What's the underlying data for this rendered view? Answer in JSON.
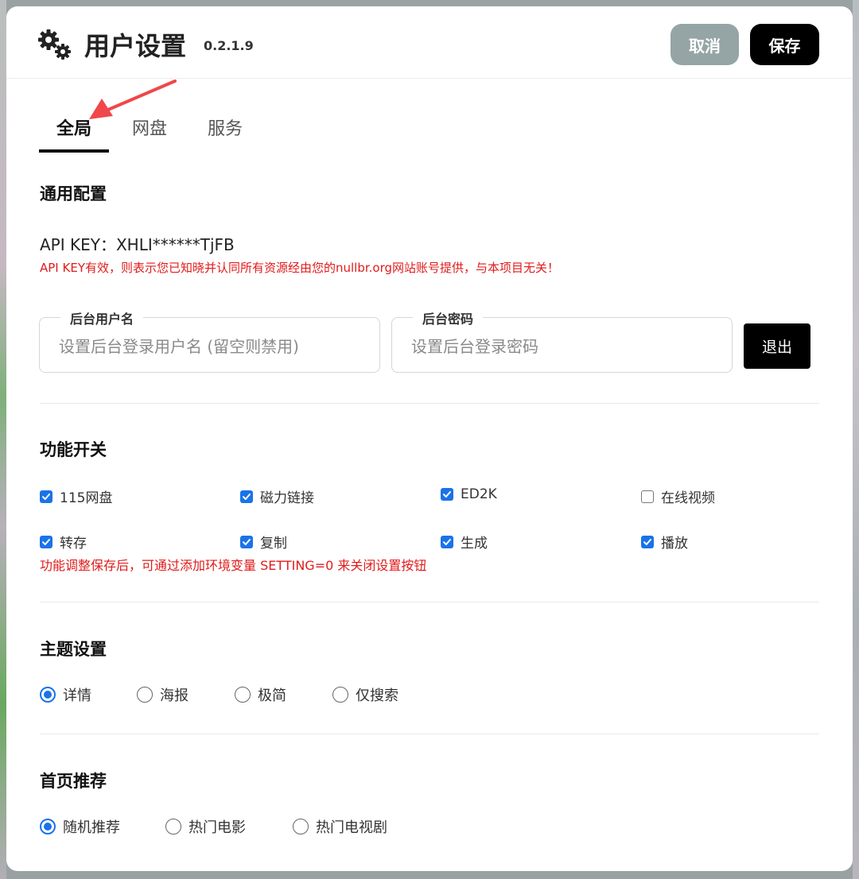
{
  "header": {
    "title": "用户设置",
    "version": "0.2.1.9",
    "cancel_label": "取消",
    "save_label": "保存"
  },
  "tabs": [
    {
      "label": "全局",
      "active": true
    },
    {
      "label": "网盘",
      "active": false
    },
    {
      "label": "服务",
      "active": false
    }
  ],
  "general": {
    "title": "通用配置",
    "api_key_line": "API KEY：XHLI******TjFB",
    "api_key_note": "API KEY有效，则表示您已知晓并认同所有资源经由您的nullbr.org网站账号提供，与本项目无关！",
    "username_label": "后台用户名",
    "username_placeholder": "设置后台登录用户名 (留空则禁用)",
    "username_value": "",
    "password_label": "后台密码",
    "password_placeholder": "设置后台登录密码",
    "password_value": "",
    "logout_label": "退出"
  },
  "features": {
    "title": "功能开关",
    "items": [
      {
        "label": "115网盘",
        "checked": true
      },
      {
        "label": "磁力链接",
        "checked": true
      },
      {
        "label": "ED2K",
        "checked": true
      },
      {
        "label": "在线视频",
        "checked": false
      },
      {
        "label": "转存",
        "checked": true
      },
      {
        "label": "复制",
        "checked": true
      },
      {
        "label": "生成",
        "checked": true
      },
      {
        "label": "播放",
        "checked": true
      }
    ],
    "note": "功能调整保存后，可通过添加环境变量 SETTING=0 来关闭设置按钮"
  },
  "theme": {
    "title": "主题设置",
    "options": [
      {
        "label": "详情",
        "selected": true
      },
      {
        "label": "海报",
        "selected": false
      },
      {
        "label": "极简",
        "selected": false
      },
      {
        "label": "仅搜索",
        "selected": false
      }
    ]
  },
  "home": {
    "title": "首页推荐",
    "options": [
      {
        "label": "随机推荐",
        "selected": true
      },
      {
        "label": "热门电影",
        "selected": false
      },
      {
        "label": "热门电视剧",
        "selected": false
      }
    ]
  },
  "colors": {
    "accent": "#1a73e8",
    "warning_text": "#e01b1b",
    "cancel_bg": "#95a5a6",
    "save_bg": "#000000",
    "annotation_arrow": "#f0474a"
  }
}
